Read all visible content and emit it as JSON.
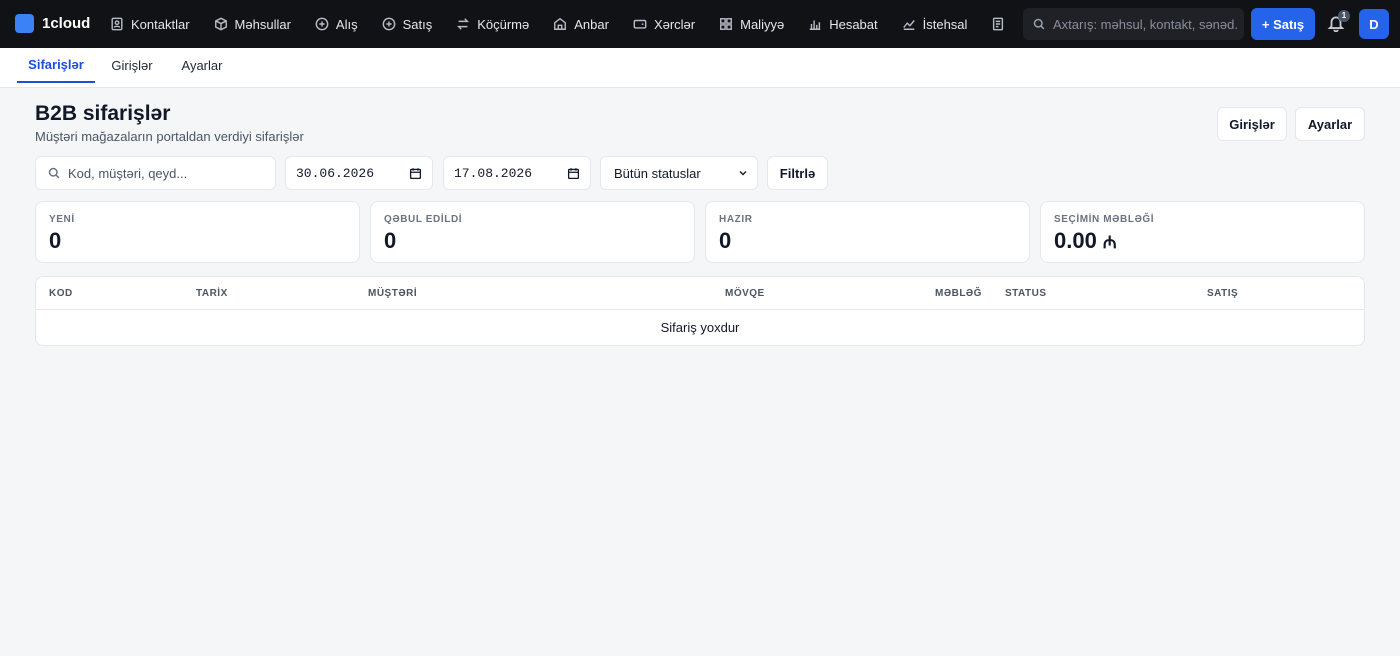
{
  "app": {
    "name": "1cloud"
  },
  "nav": [
    {
      "label": "Kontaktlar",
      "icon": "contacts-icon"
    },
    {
      "label": "Məhsullar",
      "icon": "box-icon"
    },
    {
      "label": "Alış",
      "icon": "plus-circle-icon"
    },
    {
      "label": "Satış",
      "icon": "plus-circle-icon"
    },
    {
      "label": "Köçürmə",
      "icon": "transfer-icon"
    },
    {
      "label": "Anbar",
      "icon": "warehouse-icon"
    },
    {
      "label": "Xərclər",
      "icon": "wallet-icon"
    },
    {
      "label": "Maliyyə",
      "icon": "grid-icon"
    },
    {
      "label": "Hesabat",
      "icon": "bar-chart-icon"
    },
    {
      "label": "İstehsal",
      "icon": "line-chart-icon"
    }
  ],
  "search": {
    "placeholder": "Axtarış: məhsul, kontakt, sənəd..."
  },
  "new_sale_button": "+ Satış",
  "notifications": {
    "count": "1"
  },
  "user": {
    "initial": "D"
  },
  "subtabs": {
    "orders": "Sifarişlər",
    "logins": "Girişlər",
    "settings": "Ayarlar"
  },
  "page": {
    "title": "B2B sifarişlər",
    "subtitle": "Müştəri mağazaların portaldan verdiyi sifarişlər",
    "logins_button": "Girişlər",
    "settings_button": "Ayarlar"
  },
  "filters": {
    "search_placeholder": "Kod, müştəri, qeyd...",
    "date_from": "30.06.2026",
    "date_to": "17.08.2026",
    "status_selected": "Bütün statuslar",
    "filter_button": "Filtrlə"
  },
  "stats": [
    {
      "label": "YENİ",
      "value": "0"
    },
    {
      "label": "QƏBUL EDİLDİ",
      "value": "0"
    },
    {
      "label": "HAZIR",
      "value": "0"
    },
    {
      "label": "SEÇİMİN MƏBLƏĞİ",
      "value": "0.00",
      "currency": "₼"
    }
  ],
  "table": {
    "columns": [
      "KOD",
      "TARİX",
      "MÜŞTƏRİ",
      "MÖVQE",
      "MƏBLƏĞ",
      "STATUS",
      "SATIŞ"
    ],
    "empty_message": "Sifariş yoxdur"
  },
  "colors": {
    "accent": "#2563eb",
    "topbar": "#111216",
    "background": "#f5f6f8"
  }
}
